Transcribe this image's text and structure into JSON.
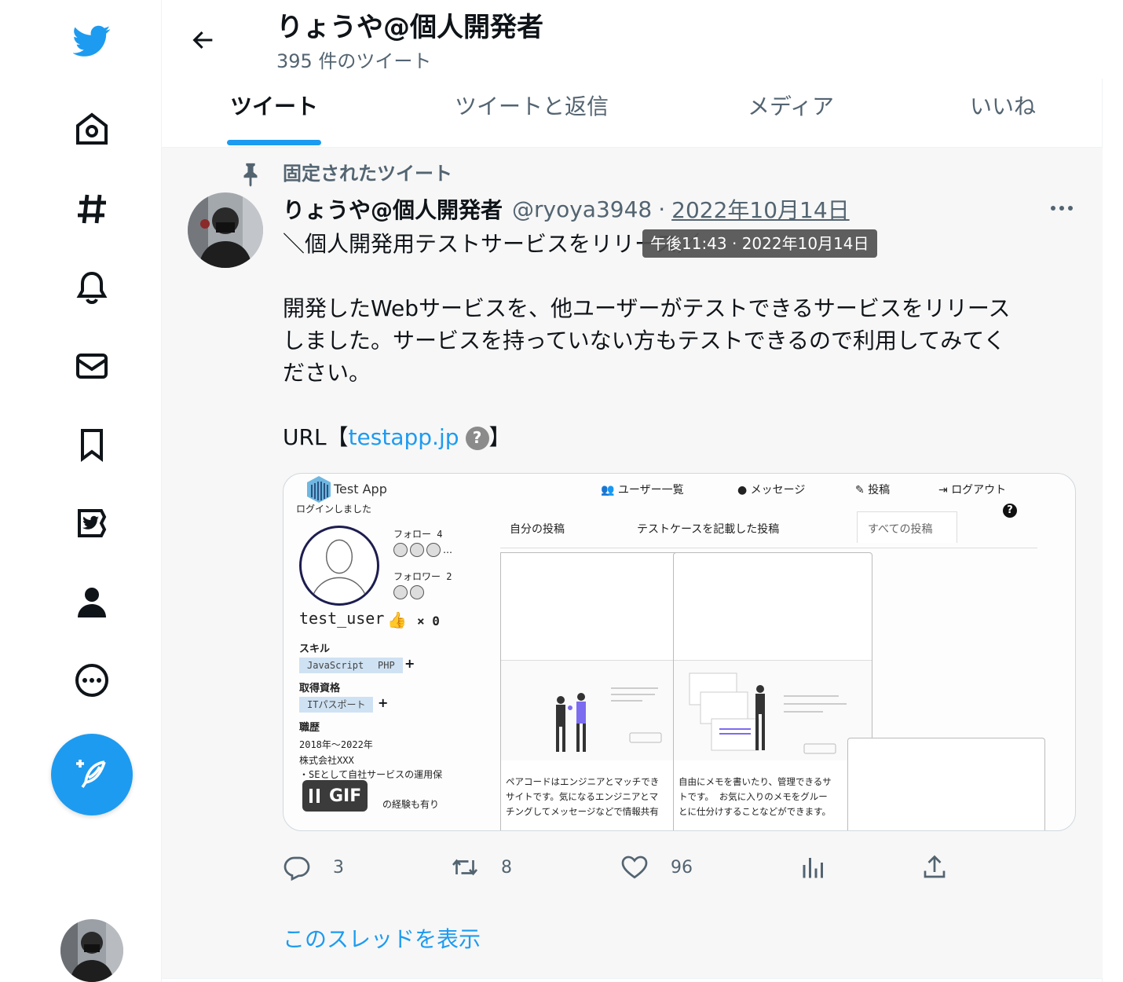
{
  "colors": {
    "accent": "#1d9bf0",
    "text": "#0f1419",
    "secondary": "#536471"
  },
  "nav": {
    "items": [
      {
        "name": "twitter-logo-icon"
      },
      {
        "name": "home-icon"
      },
      {
        "name": "explore-hashtag-icon"
      },
      {
        "name": "notifications-bell-icon"
      },
      {
        "name": "messages-envelope-icon"
      },
      {
        "name": "bookmarks-icon"
      },
      {
        "name": "twitter-blue-icon"
      },
      {
        "name": "profile-person-icon"
      },
      {
        "name": "more-circle-icon"
      }
    ],
    "compose_icon": "compose-quill-icon"
  },
  "header": {
    "profile_name": "りょうや@個人開発者",
    "tweet_count": "395 件のツイート"
  },
  "tabs": [
    {
      "label": "ツイート",
      "active": true
    },
    {
      "label": "ツイートと返信",
      "active": false
    },
    {
      "label": "メディア",
      "active": false
    },
    {
      "label": "いいね",
      "active": false
    }
  ],
  "tweet": {
    "pinned_label": "固定されたツイート",
    "author_name": "りょうや@個人開発者",
    "handle": "@ryoya3948",
    "separator": "·",
    "date": "2022年10月14日",
    "tooltip": "午後11:43 · 2022年10月14日",
    "lines": [
      "＼個人開発用テストサービスをリリース／",
      "開発したWebサービスを、他ユーザーがテストできるサービスをリリース",
      "しました。サービスを持っていない方もテストできるので利用してみてく",
      "ださい。"
    ],
    "url_prefix": "URL【",
    "url_text": "testapp.jp",
    "url_badge": "?",
    "url_suffix": "】",
    "media": {
      "app_title": "Test App",
      "login_msg": "ログインしました",
      "nav_users": "ユーザー一覧",
      "nav_messages": "メッセージ",
      "nav_post": "投稿",
      "nav_logout": "ログアウト",
      "help": "?",
      "follow_label": "フォロー 4",
      "follower_label": "フォロワー 2",
      "username": "test_user",
      "like_count": "× 0",
      "skills_label": "スキル",
      "skills": [
        "JavaScript",
        "PHP"
      ],
      "cert_label": "取得資格",
      "certs": [
        "ITパスポート"
      ],
      "career_label": "職歴",
      "career_period": "2018年～2022年",
      "career_company": "株式会社XXX",
      "career_desc": "・SEとして自社サービスの運用保",
      "career_desc2": "の経験も有り",
      "tab_mine": "自分の投稿",
      "tab_testcase": "テストケースを記載した投稿",
      "tab_all": "すべての投稿",
      "card1_text": [
        "ペアコードはエンジニアとマッチでき",
        "サイトです。気になるエンジニアとマ",
        "チングしてメッセージなどで情報共有"
      ],
      "card2_text": [
        "自由にメモを書いたり、管理できるサ",
        "トです。 お気に入りのメモをグルー",
        "とに仕分けすることなどができます。"
      ],
      "gif_label": "GIF"
    },
    "actions": {
      "reply_count": "3",
      "retweet_count": "8",
      "like_count": "96"
    },
    "show_thread": "このスレッドを表示"
  }
}
